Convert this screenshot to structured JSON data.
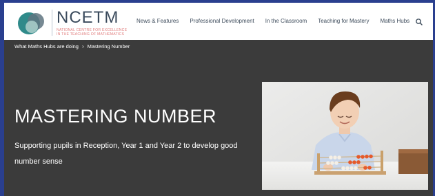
{
  "logo": {
    "wordmark": "NCETM",
    "line1": "NATIONAL CENTRE FOR EXCELLENCE",
    "line2": "IN THE TEACHING OF MATHEMATICS"
  },
  "nav": {
    "items": [
      {
        "label": "News & Features"
      },
      {
        "label": "Professional Development"
      },
      {
        "label": "In the Classroom"
      },
      {
        "label": "Teaching for Mastery"
      },
      {
        "label": "Maths Hubs"
      }
    ]
  },
  "breadcrumb": {
    "parent": "What Maths Hubs are doing",
    "separator": "›",
    "current": "Mastering Number"
  },
  "hero": {
    "title": "MASTERING NUMBER",
    "subtitle": "Supporting pupils in Reception, Year 1 and Year 2 to develop good number sense"
  },
  "colors": {
    "page_bg": "#3b3b3b",
    "outer_bg": "#2a3f8f",
    "topbar_bg": "#ffffff",
    "logo_teal": "#2f8a8a",
    "logo_grey": "#3a4a5c"
  },
  "icons": {
    "search": "search-icon",
    "logo": "ncetm-logo-icon"
  }
}
